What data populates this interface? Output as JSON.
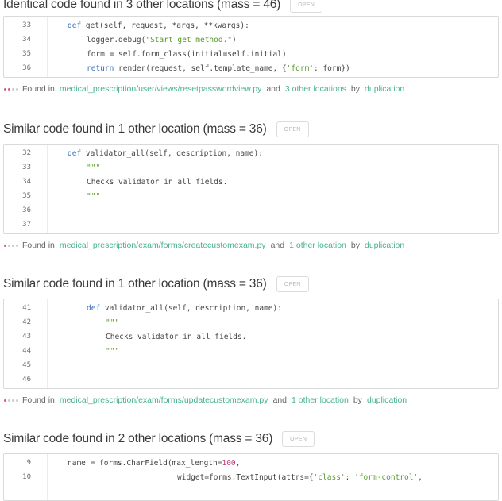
{
  "issues": [
    {
      "title": "Identical code found in 3 other locations (mass = 46)",
      "button": "OPEN",
      "lines": [
        {
          "n": "33",
          "code": "def get(self, request, *args, **kwargs):",
          "indent": 0
        },
        {
          "n": "34",
          "code": "logger.debug(\"Start get method.\")",
          "indent": 1
        },
        {
          "n": "35",
          "code": "form = self.form_class(initial=self.initial)",
          "indent": 1
        },
        {
          "n": "36",
          "code": "return render(request, self.template_name, {'form': form})",
          "indent": 1
        }
      ],
      "found_prefix": "Found in",
      "path": "medical_prescription/user/views/resetpasswordview.py",
      "and": "and",
      "others": "3 other locations",
      "by": "by",
      "engine": "duplication"
    },
    {
      "title": "Similar code found in 1 other location (mass = 36)",
      "button": "OPEN",
      "lines": [
        {
          "n": "32",
          "code": "def validator_all(self, description, name):"
        },
        {
          "n": "33",
          "code": "\"\"\""
        },
        {
          "n": "34",
          "code": "Checks validator in all fields."
        },
        {
          "n": "35",
          "code": "\"\"\""
        },
        {
          "n": "36",
          "code": ""
        },
        {
          "n": "37",
          "code": ""
        }
      ],
      "found_prefix": "Found in",
      "path": "medical_prescription/exam/forms/createcustomexam.py",
      "and": "and",
      "others": "1 other location",
      "by": "by",
      "engine": "duplication"
    },
    {
      "title": "Similar code found in 1 other location (mass = 36)",
      "button": "OPEN",
      "lines": [
        {
          "n": "41",
          "code": "def validator_all(self, description, name):"
        },
        {
          "n": "42",
          "code": "\"\"\""
        },
        {
          "n": "43",
          "code": "Checks validator in all fields."
        },
        {
          "n": "44",
          "code": "\"\"\""
        },
        {
          "n": "45",
          "code": ""
        },
        {
          "n": "46",
          "code": ""
        }
      ],
      "found_prefix": "Found in",
      "path": "medical_prescription/exam/forms/updatecustomexam.py",
      "and": "and",
      "others": "1 other location",
      "by": "by",
      "engine": "duplication"
    },
    {
      "title": "Similar code found in 2 other locations (mass = 36)",
      "button": "OPEN",
      "lines": [
        {
          "n": "9",
          "code": "name = forms.CharField(max_length=100,"
        },
        {
          "n": "10",
          "code": "widget=forms.TextInput(attrs={'class': 'form-control',"
        }
      ]
    }
  ]
}
